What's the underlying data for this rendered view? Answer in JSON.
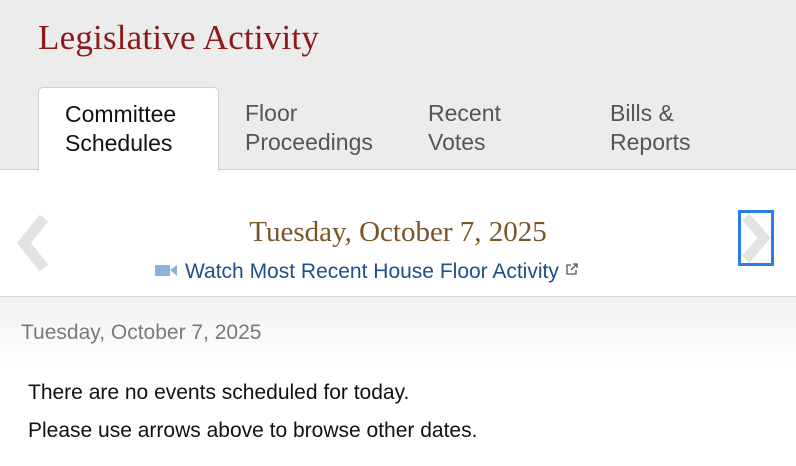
{
  "header": {
    "title": "Legislative Activity",
    "tabs": [
      {
        "line1": "Committee",
        "line2": "Schedules",
        "active": true
      },
      {
        "line1": "Floor",
        "line2": "Proceedings",
        "active": false
      },
      {
        "line1": "Recent",
        "line2": "Votes",
        "active": false
      },
      {
        "line1": "Bills &",
        "line2": "Reports",
        "active": false
      }
    ]
  },
  "date_nav": {
    "current_date": "Tuesday, October 7, 2025",
    "watch_link": "Watch Most Recent House Floor Activity",
    "prev_icon": "chevron-left-icon",
    "next_icon": "chevron-right-icon"
  },
  "day_panel": {
    "heading": "Tuesday, October 7, 2025",
    "messages": [
      "There are no events scheduled for today.",
      "Please use arrows above to browse other dates."
    ]
  },
  "colors": {
    "title": "#8b1a1a",
    "date": "#7a5528",
    "link": "#1f4e8a",
    "focus": "#2a7de1"
  }
}
